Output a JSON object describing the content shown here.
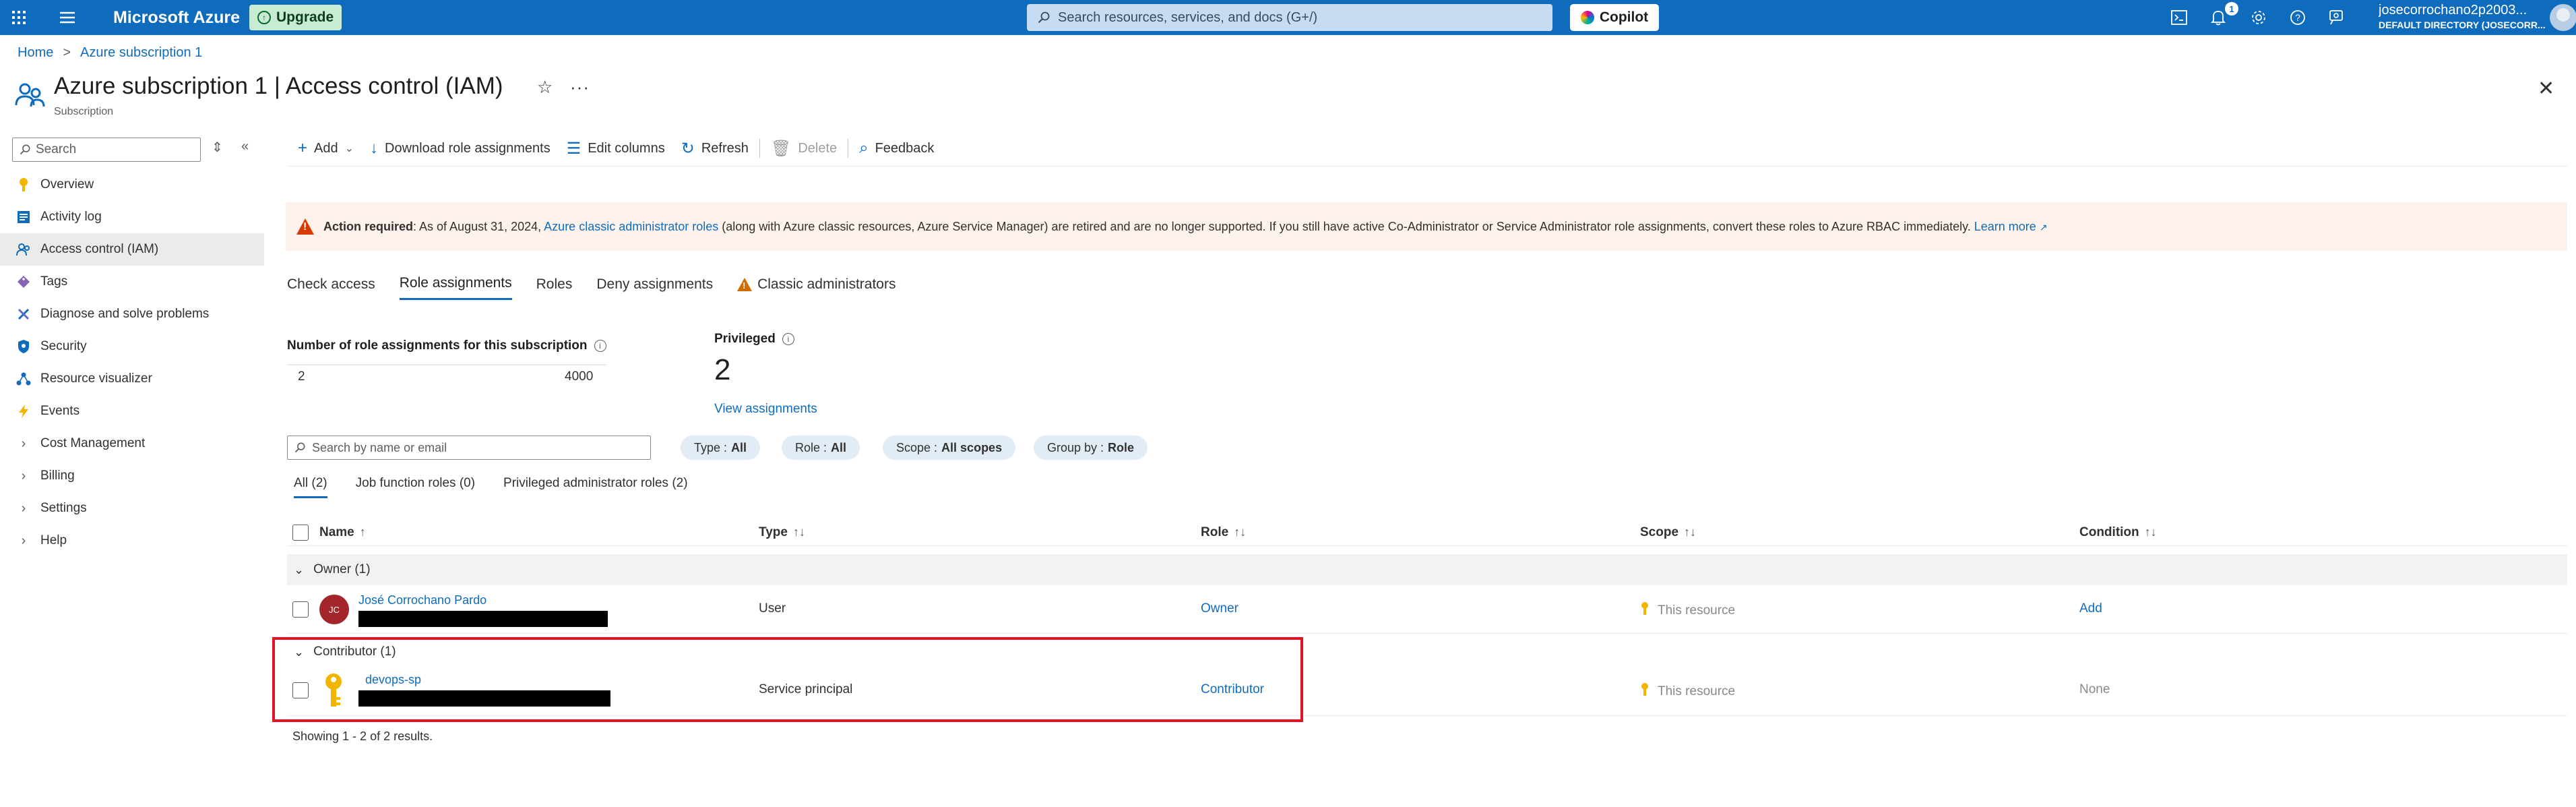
{
  "topbar": {
    "brand": "Microsoft Azure",
    "upgrade_label": "Upgrade",
    "search_placeholder": "Search resources, services, and docs (G+/)",
    "copilot_label": "Copilot",
    "notifications_count": "1",
    "user_name": "josecorrochano2p2003...",
    "user_directory": "DEFAULT DIRECTORY (JOSECORR..."
  },
  "breadcrumb": [
    "Home",
    "Azure subscription 1"
  ],
  "page": {
    "title": "Azure subscription 1 | Access control (IAM)",
    "subtitle": "Subscription"
  },
  "sidebar": {
    "search_placeholder": "Search",
    "items": [
      {
        "label": "Overview",
        "icon": "key-icon"
      },
      {
        "label": "Activity log",
        "icon": "activity-log-icon"
      },
      {
        "label": "Access control (IAM)",
        "icon": "people-icon",
        "active": true
      },
      {
        "label": "Tags",
        "icon": "tag-icon"
      },
      {
        "label": "Diagnose and solve problems",
        "icon": "wrench-icon"
      },
      {
        "label": "Security",
        "icon": "shield-icon"
      },
      {
        "label": "Resource visualizer",
        "icon": "graph-icon"
      },
      {
        "label": "Events",
        "icon": "lightning-icon"
      },
      {
        "label": "Cost Management",
        "icon": "chevron-right-icon"
      },
      {
        "label": "Billing",
        "icon": "chevron-right-icon"
      },
      {
        "label": "Settings",
        "icon": "chevron-right-icon"
      },
      {
        "label": "Help",
        "icon": "chevron-right-icon"
      }
    ]
  },
  "toolbar": {
    "add": "Add",
    "download": "Download role assignments",
    "edit_columns": "Edit columns",
    "refresh": "Refresh",
    "delete": "Delete",
    "feedback": "Feedback"
  },
  "banner": {
    "bold": "Action required",
    "text1": ": As of August 31, 2024, ",
    "link1": "Azure classic administrator roles",
    "text2": " (along with Azure classic resources, Azure Service Manager) are retired and are no longer supported. If you still have active Co-Administrator or Service Administrator role assignments, convert these roles to Azure RBAC immediately. ",
    "link2": "Learn more"
  },
  "tabs": [
    "Check access",
    "Role assignments",
    "Roles",
    "Deny assignments",
    "Classic administrators"
  ],
  "stats": {
    "count_label": "Number of role assignments for this subscription",
    "count_current": "2",
    "count_max": "4000",
    "privileged_label": "Privileged",
    "privileged_value": "2",
    "view_assignments": "View assignments"
  },
  "filters": {
    "search_placeholder": "Search by name or email",
    "type_label": "Type :",
    "type_value": "All",
    "role_label": "Role :",
    "role_value": "All",
    "scope_label": "Scope :",
    "scope_value": "All scopes",
    "group_label": "Group by :",
    "group_value": "Role"
  },
  "subtabs": [
    "All (2)",
    "Job function roles (0)",
    "Privileged administrator roles (2)"
  ],
  "table": {
    "headers": [
      "Name",
      "Type",
      "Role",
      "Scope",
      "Condition"
    ],
    "groups": [
      {
        "label": "Owner (1)",
        "rows": [
          {
            "avatar_initials": "JC",
            "name": "José Corrochano Pardo",
            "type": "User",
            "role": "Owner",
            "scope": "This resource",
            "condition": "Add"
          }
        ]
      },
      {
        "label": "Contributor (1)",
        "rows": [
          {
            "avatar_initials": "",
            "name": "devops-sp",
            "type": "Service principal",
            "role": "Contributor",
            "scope": "This resource",
            "condition": "None"
          }
        ]
      }
    ],
    "footer": "Showing 1 - 2 of 2 results."
  },
  "colors": {
    "accent": "#0f6cbd",
    "topbar": "#0f6cbd",
    "warning": "#d83b01",
    "highlight": "#e81123"
  }
}
